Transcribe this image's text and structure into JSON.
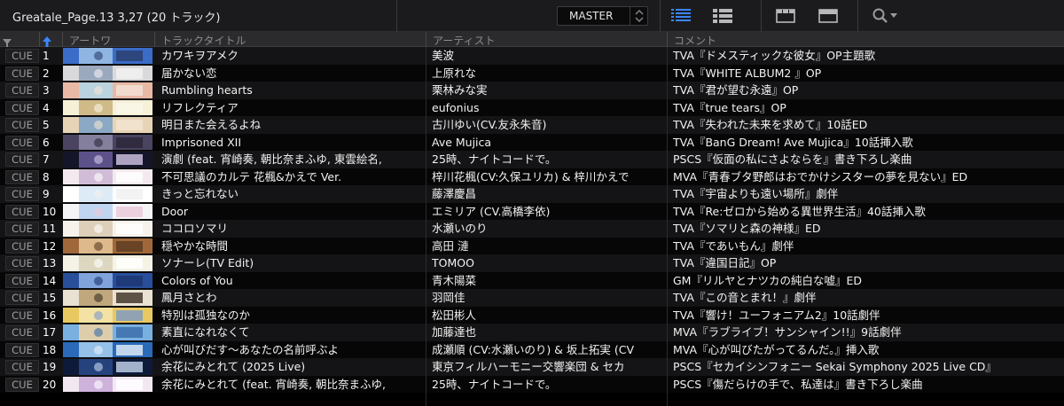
{
  "header": {
    "title": "Greatale_Page.13 3,27 (20 トラック)",
    "deck_select": "MASTER",
    "icons": [
      "list-view-icon",
      "detail-list-icon",
      "layout-a-icon",
      "layout-b-icon",
      "search-icon"
    ]
  },
  "columns": {
    "artwork": "アートワ",
    "title": "トラックタイトル",
    "artist": "アーティスト",
    "comment": "コメント"
  },
  "cue_label": "CUE",
  "tracks": [
    {
      "no": "1",
      "title": "カワキヲアメク",
      "artist": "美波",
      "comment": "TVA『ドメスティックな彼女』OP主題歌",
      "art": [
        "#3a6cc8",
        "#9fc2e8",
        "#2b3d6b"
      ]
    },
    {
      "no": "2",
      "title": "届かない恋",
      "artist": "上原れな",
      "comment": "TVA『WHITE ALBUM2 』OP",
      "art": [
        "#d9d9dc",
        "#8fa0b8",
        "#f2f2f4"
      ]
    },
    {
      "no": "3",
      "title": "Rumbling hearts",
      "artist": "栗林みな実",
      "comment": "TVA『君が望む永遠』OP",
      "art": [
        "#e9b9a6",
        "#b3d6e9",
        "#f4e4d8"
      ]
    },
    {
      "no": "4",
      "title": "リフレクティア",
      "artist": "eufonius",
      "comment": "TVA『true tears』OP",
      "art": [
        "#f5f0d6",
        "#c8b07a",
        "#faf7ea"
      ]
    },
    {
      "no": "5",
      "title": "明日また会えるよね",
      "artist": "古川ゆい(CV.友永朱音)",
      "comment": "TVA『失われた未来を求めて』10話ED",
      "art": [
        "#e7d3b6",
        "#7aa0c8",
        "#f2e6d2"
      ]
    },
    {
      "no": "6",
      "title": "Imprisoned XII",
      "artist": "Ave Mujica",
      "comment": "TVA『BanG Dream! Ave Mujica』10話挿入歌",
      "art": [
        "#4a4460",
        "#8d8aa8",
        "#2a2638"
      ]
    },
    {
      "no": "7",
      "title": "演劇 (feat. 宵崎奏, 朝比奈まふゆ, 東雲絵名,",
      "artist": "25時、ナイトコードで。",
      "comment": "PSCS『仮面の私にさよならを』書き下ろし楽曲",
      "art": [
        "#15152a",
        "#6a5c9a",
        "#d4c8e8"
      ]
    },
    {
      "no": "8",
      "title": "不可思議のカルテ 花楓&かえで Ver.",
      "artist": "梓川花楓(CV:久保ユリカ) & 梓川かえで",
      "comment": "MVA『青春ブタ野郎はおでかけシスターの夢を見ない』ED",
      "art": [
        "#f3e9ee",
        "#c9b4d2",
        "#ffffff"
      ]
    },
    {
      "no": "9",
      "title": "きっと忘れない",
      "artist": "藤澤慶昌",
      "comment": "TVA『宇宙よりも遠い場所』劇伴",
      "art": [
        "#ffffff",
        "#d6e8f5",
        "#f0f0f0"
      ]
    },
    {
      "no": "10",
      "title": "Door",
      "artist": "エミリア (CV.高橋李依)",
      "comment": "TVA『Re:ゼロから始める異世界生活』40話挿入歌",
      "art": [
        "#f4f4f6",
        "#b6d0ee",
        "#e8c8d8"
      ]
    },
    {
      "no": "11",
      "title": "ココロソマリ",
      "artist": "水瀬いのり",
      "comment": "TVA『ソマリと森の神様』ED",
      "art": [
        "#f7f3ec",
        "#d8c8b0",
        "#ffffff"
      ]
    },
    {
      "no": "12",
      "title": "穏やかな時間",
      "artist": "高田 漣",
      "comment": "TVA『であいもん』劇伴",
      "art": [
        "#a0683a",
        "#e8c89a",
        "#5a3a22"
      ]
    },
    {
      "no": "13",
      "title": "ソナーレ(TV Edit)",
      "artist": "TOMOO",
      "comment": "TVA『違国日記』OP",
      "art": [
        "#f5f2e6",
        "#d9d2b8",
        "#ffffff"
      ]
    },
    {
      "no": "14",
      "title": "Colors of You",
      "artist": "青木陽菜",
      "comment": "GM『リルヤとナツカの純白な嘘』ED",
      "art": [
        "#2a4f9a",
        "#8fb2e6",
        "#1b3470"
      ]
    },
    {
      "no": "15",
      "title": "鳳月さとわ",
      "artist": "羽岡佳",
      "comment": "TVA『この音とまれ！』劇伴",
      "art": [
        "#e9e2d2",
        "#b89c6e",
        "#3a2e22"
      ]
    },
    {
      "no": "16",
      "title": "特別は孤独なのか",
      "artist": "松田彬人",
      "comment": "TVA『響け！ユーフォニアム2』10話劇伴",
      "art": [
        "#e8c860",
        "#f4e6b0",
        "#7a9ac8"
      ]
    },
    {
      "no": "17",
      "title": "素直になれなくて",
      "artist": "加藤達也",
      "comment": "MVA『ラブライブ！サンシャイン!!』9話劇伴",
      "art": [
        "#7ab0e0",
        "#f0d2a0",
        "#3a6aa8"
      ]
    },
    {
      "no": "18",
      "title": "心が叫びだす〜あなたの名前呼ぶよ",
      "artist": "成瀬順 (CV:水瀬いのり) & 坂上拓実 (CV",
      "comment": "MVA『心が叫びたがってるんだ。』挿入歌",
      "art": [
        "#2a6ab8",
        "#a8d0f0",
        "#e8f2fa"
      ]
    },
    {
      "no": "19",
      "title": "余花にみとれて (2025 Live)",
      "artist": "東京フィルハーモニー交響楽団 & セカ",
      "comment": "PSCS『セカイシンフォニー Sekai Symphony 2025 Live CD』",
      "art": [
        "#0e1a3a",
        "#2a4a8a",
        "#c8d8f0"
      ]
    },
    {
      "no": "20",
      "title": "余花にみとれて (feat. 宵崎奏, 朝比奈まふゆ,",
      "artist": "25時、ナイトコードで。",
      "comment": "PSCS『傷だらけの手で、私達は』書き下ろし楽曲",
      "art": [
        "#f2e8f2",
        "#c8a8d8",
        "#ffffff"
      ]
    }
  ]
}
